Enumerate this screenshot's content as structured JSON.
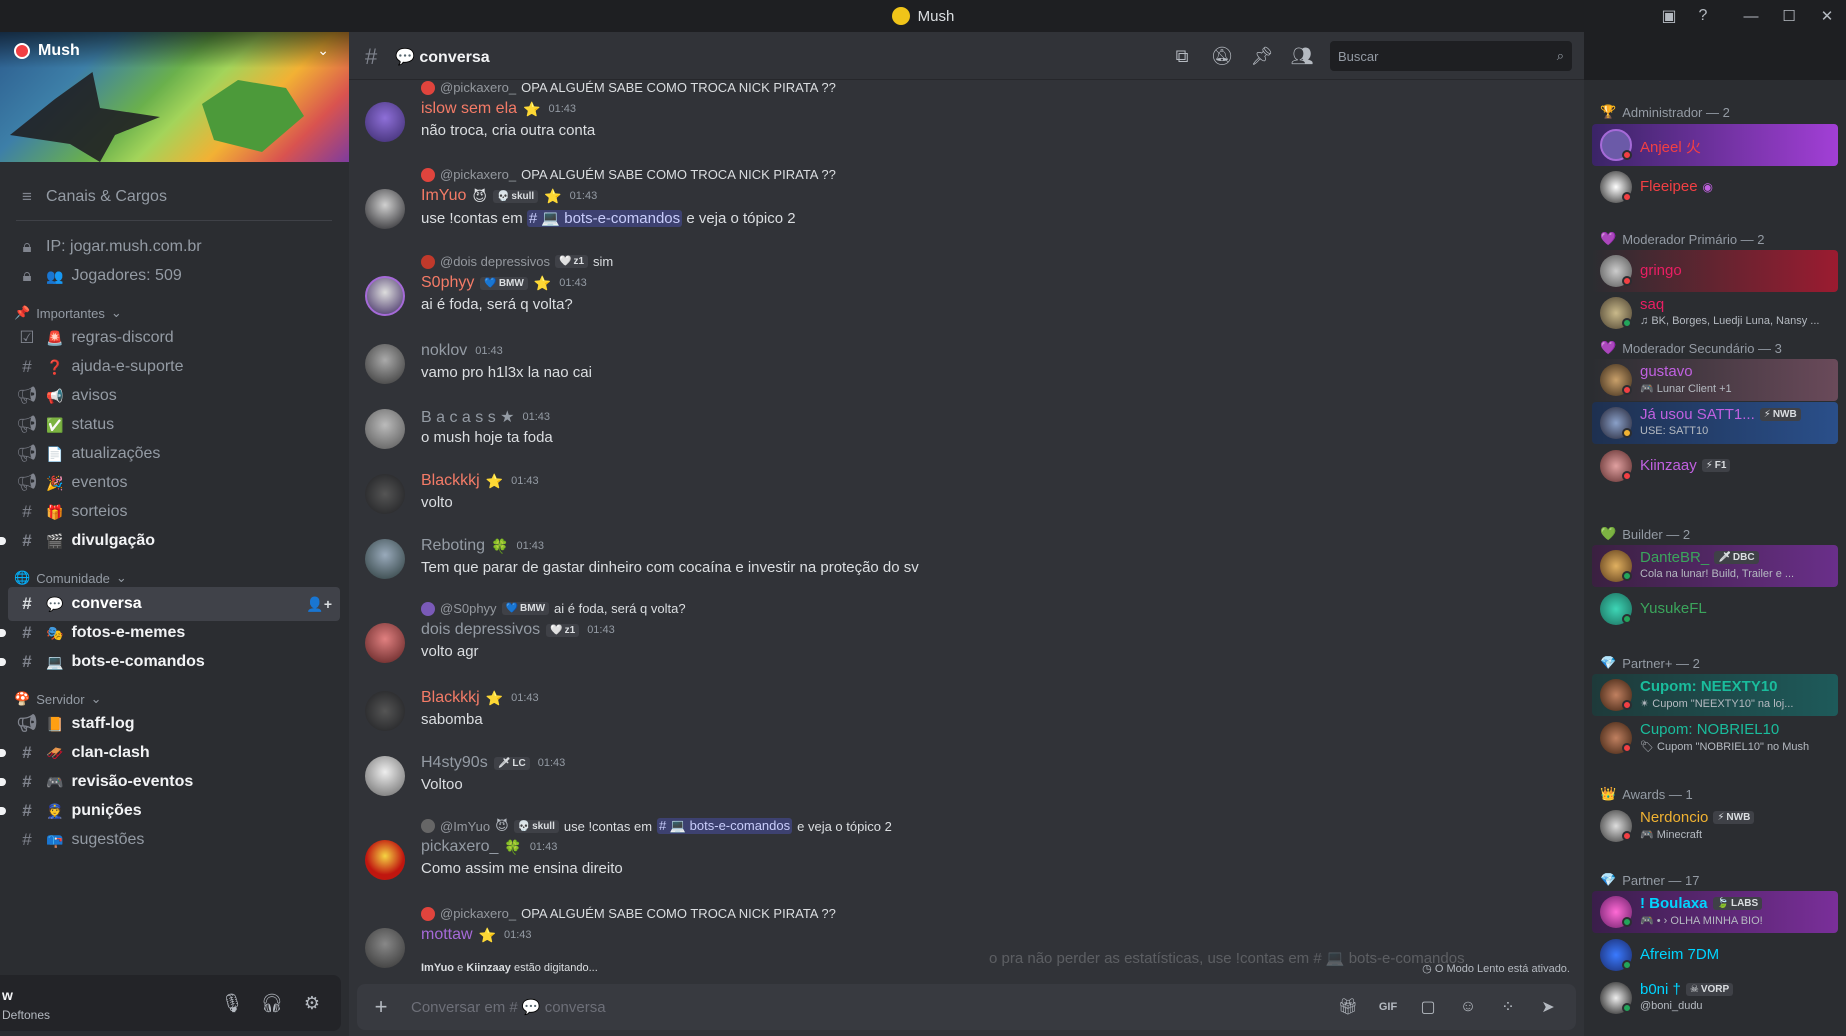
{
  "titlebar": {
    "title": "Mush"
  },
  "guild": {
    "name": "Mush"
  },
  "sidebar": {
    "top_item": "Canais & Cargos",
    "info": [
      {
        "label": "IP: jogar.mush.com.br"
      },
      {
        "label": "Jogadores: 509"
      }
    ],
    "categories": [
      {
        "name": "Importantes",
        "channels": [
          {
            "prefix": "🚨",
            "label": "regras-discord",
            "icon": "rules-icon"
          },
          {
            "prefix": "❓",
            "label": "ajuda-e-suporte",
            "icon": "hash-icon"
          },
          {
            "prefix": "📢",
            "label": "avisos",
            "icon": "announcement-icon"
          },
          {
            "prefix": "✅",
            "label": "status",
            "icon": "announcement-icon"
          },
          {
            "prefix": "📄",
            "label": "atualizações",
            "icon": "announcement-icon"
          },
          {
            "prefix": "🎉",
            "label": "eventos",
            "icon": "announcement-icon"
          },
          {
            "prefix": "🎁",
            "label": "sorteios",
            "icon": "hash-icon"
          },
          {
            "prefix": "🎬",
            "label": "divulgação",
            "icon": "hash-icon"
          }
        ]
      },
      {
        "name": "Comunidade",
        "channels": [
          {
            "prefix": "💬",
            "label": "conversa",
            "icon": "hash-icon"
          },
          {
            "prefix": "🎭",
            "label": "fotos-e-memes",
            "icon": "hash-icon"
          },
          {
            "prefix": "💻",
            "label": "bots-e-comandos",
            "icon": "hash-icon"
          }
        ]
      },
      {
        "name": "Servidor",
        "channels": [
          {
            "prefix": "📙",
            "label": "staff-log",
            "icon": "announcement-icon"
          },
          {
            "prefix": "🛷",
            "label": "clan-clash",
            "icon": "hash-icon"
          },
          {
            "prefix": "🎮",
            "label": "revisão-eventos",
            "icon": "hash-icon"
          },
          {
            "prefix": "👮",
            "label": "punições",
            "icon": "hash-icon"
          },
          {
            "prefix": "📪",
            "label": "sugestões",
            "icon": "hash-icon"
          }
        ]
      }
    ]
  },
  "user_panel": {
    "name": "w",
    "status": "Deftones"
  },
  "channel": {
    "name": "conversa",
    "emoji": "💬"
  },
  "search": {
    "placeholder": "Buscar"
  },
  "messages": [
    {
      "reply_name": "@pickaxero_",
      "reply_text": "OPA ALGUÉM SABE COMO TROCA NICK PIRATA ??",
      "author": "islow sem ela",
      "color": "#f47b67",
      "badge": "⭐",
      "tag": "",
      "time": "01:43",
      "content": "não troca, cria outra conta"
    },
    {
      "reply_name": "@pickaxero_",
      "reply_text": "OPA ALGUÉM SABE COMO TROCA NICK PIRATA ??",
      "author": "ImYuo",
      "color": "#f47b67",
      "badge": "⭐",
      "tag": "skull",
      "time": "01:43",
      "content_pre": "use !contas em",
      "mention": "# 💻 bots-e-comandos",
      "content_post": "e veja o tópico 2"
    },
    {
      "reply_name": "@dois depressivos",
      "reply_text": "sim",
      "reply_tag": "z1",
      "author": "S0phyy",
      "color": "#f47b67",
      "badge": "⭐",
      "tag": "BMW",
      "time": "01:43",
      "content": "ai é foda, será q volta?"
    },
    {
      "author": "noklov",
      "color": "#949ba4",
      "time": "01:43",
      "content": "vamo pro h1l3x la nao cai"
    },
    {
      "author": "B a c a s s ★",
      "color": "#949ba4",
      "time": "01:43",
      "content": "o mush hoje ta foda"
    },
    {
      "author": "Blackkkj",
      "color": "#f47b67",
      "badge": "⭐",
      "time": "01:43",
      "content": "volto"
    },
    {
      "author": "Reboting",
      "color": "#949ba4",
      "badge": "🍀",
      "time": "01:43",
      "content": "Tem que parar de gastar dinheiro com cocaína e investir na proteção do sv"
    },
    {
      "reply_name": "@S0phyy",
      "reply_text": "ai é foda, será q volta?",
      "reply_tag": "BMW",
      "author": "dois depressivos",
      "color": "#949ba4",
      "tag": "z1",
      "time": "01:43",
      "content": "volto agr"
    },
    {
      "author": "Blackkkj",
      "color": "#f47b67",
      "badge": "⭐",
      "time": "01:43",
      "content": "sabomba"
    },
    {
      "author": "H4sty90s",
      "color": "#949ba4",
      "tag": "LC",
      "time": "01:43",
      "content": "Voltoo"
    },
    {
      "reply_name": "@ImYuo",
      "reply_text_pre": "use !contas em",
      "reply_mention": "# 💻 bots-e-comandos",
      "reply_text_post": "e veja o tópico 2",
      "reply_tag": "skull",
      "author": "pickaxero_",
      "color": "#949ba4",
      "badge": "🍀",
      "time": "01:43",
      "content": "Como assim me ensina direito"
    },
    {
      "reply_name": "@pickaxero_",
      "reply_text": "OPA ALGUÉM SABE COMO TROCA NICK PIRATA ??",
      "author": "mottaw",
      "color": "#a56ad8",
      "badge": "⭐",
      "time": "01:43"
    }
  ],
  "typing": {
    "user1": "ImYuo",
    "conj": "e",
    "user2": "Kiinzaay",
    "suffix": "estão digitando...",
    "faded": "o pra não perder as estatísticas, use !contas em # 💻 bots-e-comandos"
  },
  "slowmode": "O Modo Lento está ativado.",
  "composer": {
    "placeholder": "Conversar em # 💬 conversa"
  },
  "members": {
    "groups": [
      {
        "role": "Administrador — 2",
        "items": [
          {
            "name": "Anjeel 火",
            "color": "#f23f43",
            "status": "dnd",
            "highlight": "#8b2fc9"
          },
          {
            "name": "Fleeipee",
            "color": "#f23f43",
            "status": "dnd"
          }
        ]
      },
      {
        "role": "Moderador Primário — 2",
        "items": [
          {
            "name": "gringo",
            "color": "#e91e63",
            "status": "dnd",
            "highlight": "#9b1b30"
          },
          {
            "name": "saq",
            "color": "#e91e63",
            "status": "online",
            "sub": "BK, Borges, Luedji Luna, Nansy ..."
          }
        ]
      },
      {
        "role": "Moderador Secundário — 3",
        "items": [
          {
            "name": "gustavo",
            "color": "#c061e0",
            "status": "dnd",
            "sub": "Lunar Client +1",
            "highlight": "#5a3a4a"
          },
          {
            "name": "Já usou SATT1...",
            "color": "#c061e0",
            "status": "idle",
            "tag": "NWB",
            "sub": "USE: SATT10",
            "highlight": "#2a3f6a"
          },
          {
            "name": "Kiinzaay",
            "color": "#c061e0",
            "status": "dnd",
            "tag": "F1"
          }
        ]
      },
      {
        "role": "Builder — 2",
        "items": [
          {
            "name": "DanteBR_",
            "color": "#3ba55c",
            "status": "online",
            "tag": "DBC",
            "sub": "Cola na lunar! Build, Trailer e ...",
            "highlight": "#4a2a5a"
          },
          {
            "name": "YusukeFL",
            "color": "#3ba55c",
            "status": "online"
          }
        ]
      },
      {
        "role": "Partner+ — 2",
        "items": [
          {
            "name": "Cupom: NEEXTY10",
            "color": "#1abc9c",
            "status": "dnd",
            "sub": "Cupom \"NEEXTY10\" na loj...",
            "highlight": "#1e4d4d"
          },
          {
            "name": "Cupom: NOBRIEL10",
            "color": "#1abc9c",
            "status": "dnd",
            "sub": "Cupom \"NOBRIEL10\" no Mush"
          }
        ]
      },
      {
        "role": "Awards — 1",
        "items": [
          {
            "name": "Nerdoncio",
            "color": "#f0b232",
            "status": "dnd",
            "tag": "NWB",
            "sub": "Minecraft"
          }
        ]
      },
      {
        "role": "Partner — 17",
        "items": [
          {
            "name": "! Boulaxa",
            "color": "#00d4ff",
            "status": "online",
            "tag": "LABS",
            "sub": "OLHA MINHA BIO!",
            "highlight": "#5a1f6a"
          },
          {
            "name": "Afreim 7DM",
            "color": "#00d4ff",
            "status": "online"
          },
          {
            "name": "b0ni †",
            "color": "#00d4ff",
            "status": "online",
            "tag": "VORP",
            "sub": "@boni_dudu"
          }
        ]
      }
    ]
  }
}
